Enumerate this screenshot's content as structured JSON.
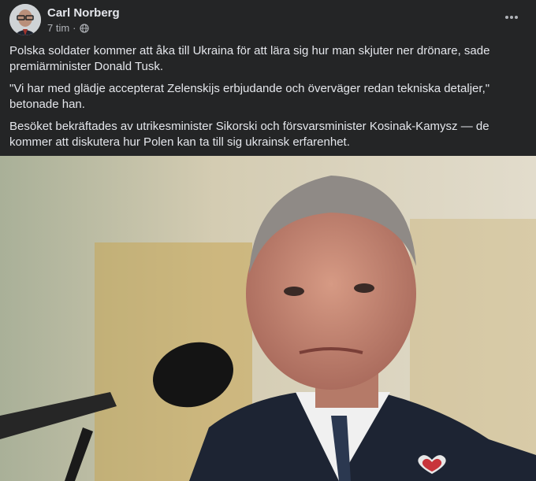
{
  "post": {
    "author": "Carl Norberg",
    "time": "7 tim",
    "separator": "·",
    "privacy_icon": "globe-icon",
    "more_icon": "more-horizontal-icon",
    "paragraphs": [
      "Polska soldater kommer att åka till Ukraina för att lära sig hur man skjuter ner drönare, sade premiärminister Donald Tusk.",
      "\"Vi har med glädje accepterat Zelenskijs erbjudande och överväger redan tekniska detaljer,\" betonade han.",
      "Besöket bekräftades av utrikesminister Sikorski och försvarsminister Kosinak-Kamysz — de kommer att diskutera hur Polen kan ta till sig ukrainsk erfarenhet."
    ]
  },
  "colors": {
    "background": "#242526",
    "primary_text": "#e4e6eb",
    "secondary_text": "#b0b3b8"
  }
}
